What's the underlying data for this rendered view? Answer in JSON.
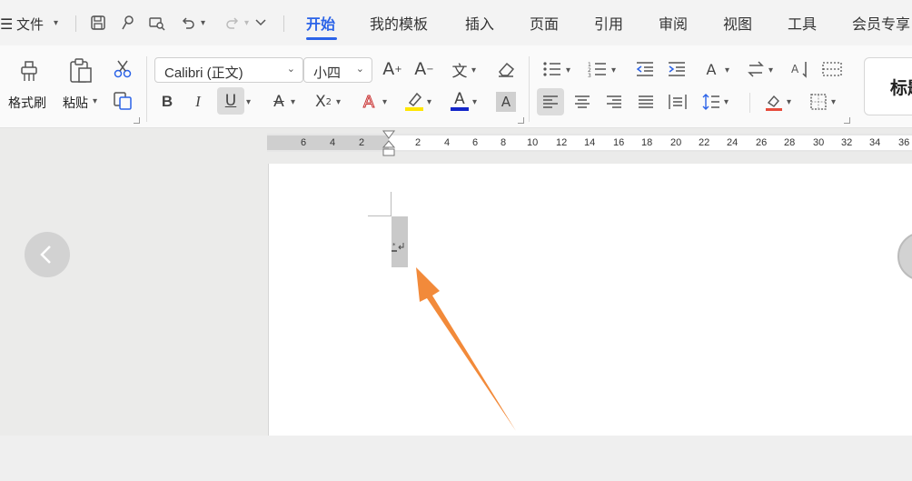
{
  "menu": {
    "file_label": "文件",
    "tabs": [
      {
        "label": "开始",
        "active": true
      },
      {
        "label": "我的模板"
      },
      {
        "label": "插入"
      },
      {
        "label": "页面"
      },
      {
        "label": "引用"
      },
      {
        "label": "审阅"
      },
      {
        "label": "视图"
      },
      {
        "label": "工具"
      },
      {
        "label": "会员专享"
      }
    ]
  },
  "ribbon": {
    "format_painter_label": "格式刷",
    "paste_label": "粘贴",
    "font_name": "Calibri (正文)",
    "font_size": "小四",
    "style_preview": "标题"
  },
  "ruler": {
    "ticks": [
      "6",
      "4",
      "2",
      "2",
      "4",
      "6",
      "8",
      "10",
      "12",
      "14",
      "16",
      "18",
      "20",
      "22",
      "24",
      "26",
      "28",
      "30",
      "32",
      "34",
      "36"
    ]
  },
  "colors": {
    "accent": "#2b63e8",
    "annotation_arrow": "#f28a3a",
    "highlight_yellow": "#ffe600",
    "font_color_blue": "#1326c9",
    "paragraph_mark_selection": "#c9c9c9"
  }
}
